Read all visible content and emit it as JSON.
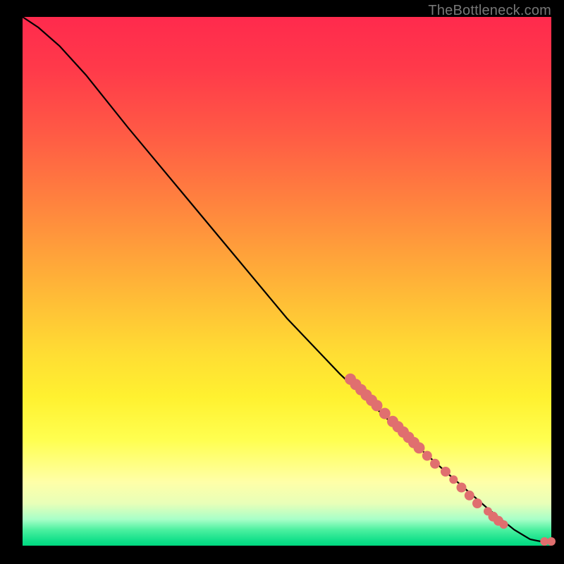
{
  "attribution": "TheBottleneck.com",
  "colors": {
    "curve": "#000000",
    "marker": "#e06f6f",
    "gradient_top": "#ff2a4d",
    "gradient_bottom": "#00d880"
  },
  "chart_data": {
    "type": "line",
    "title": "",
    "xlabel": "",
    "ylabel": "",
    "xlim": [
      0,
      100
    ],
    "ylim": [
      0,
      100
    ],
    "grid": false,
    "legend": false,
    "curve": [
      {
        "x": 0,
        "y": 100
      },
      {
        "x": 3,
        "y": 98
      },
      {
        "x": 7,
        "y": 94.5
      },
      {
        "x": 12,
        "y": 89
      },
      {
        "x": 20,
        "y": 79
      },
      {
        "x": 30,
        "y": 67
      },
      {
        "x": 40,
        "y": 55
      },
      {
        "x": 50,
        "y": 43
      },
      {
        "x": 60,
        "y": 32.5
      },
      {
        "x": 70,
        "y": 23
      },
      {
        "x": 80,
        "y": 14
      },
      {
        "x": 88,
        "y": 7
      },
      {
        "x": 93,
        "y": 3
      },
      {
        "x": 96,
        "y": 1.2
      },
      {
        "x": 98,
        "y": 0.8
      },
      {
        "x": 100,
        "y": 0.8
      }
    ],
    "markers": [
      {
        "x": 62,
        "y": 31.5,
        "r": 8
      },
      {
        "x": 63,
        "y": 30.5,
        "r": 8
      },
      {
        "x": 64,
        "y": 29.5,
        "r": 8
      },
      {
        "x": 65,
        "y": 28.5,
        "r": 8
      },
      {
        "x": 66,
        "y": 27.5,
        "r": 8
      },
      {
        "x": 67,
        "y": 26.5,
        "r": 8
      },
      {
        "x": 68.5,
        "y": 25,
        "r": 8
      },
      {
        "x": 70,
        "y": 23.5,
        "r": 8
      },
      {
        "x": 71,
        "y": 22.5,
        "r": 8
      },
      {
        "x": 72,
        "y": 21.5,
        "r": 8
      },
      {
        "x": 73,
        "y": 20.5,
        "r": 8
      },
      {
        "x": 74,
        "y": 19.5,
        "r": 8
      },
      {
        "x": 75,
        "y": 18.5,
        "r": 8
      },
      {
        "x": 76.5,
        "y": 17,
        "r": 7
      },
      {
        "x": 78,
        "y": 15.5,
        "r": 7
      },
      {
        "x": 80,
        "y": 14,
        "r": 7
      },
      {
        "x": 81.5,
        "y": 12.5,
        "r": 6
      },
      {
        "x": 83,
        "y": 11,
        "r": 7
      },
      {
        "x": 84.5,
        "y": 9.5,
        "r": 7
      },
      {
        "x": 86,
        "y": 8,
        "r": 7
      },
      {
        "x": 88,
        "y": 6.5,
        "r": 6
      },
      {
        "x": 89,
        "y": 5.5,
        "r": 7
      },
      {
        "x": 90,
        "y": 4.7,
        "r": 7
      },
      {
        "x": 91,
        "y": 4,
        "r": 6
      },
      {
        "x": 98.7,
        "y": 0.8,
        "r": 6
      },
      {
        "x": 100,
        "y": 0.8,
        "r": 6
      }
    ]
  }
}
